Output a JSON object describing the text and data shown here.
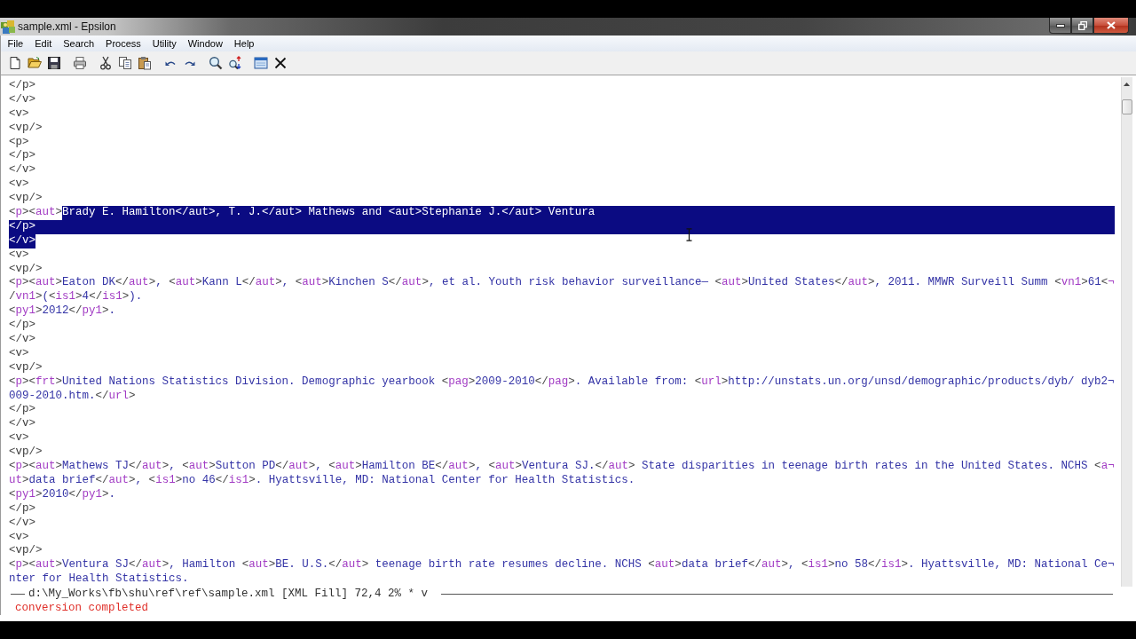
{
  "window": {
    "title": "sample.xml - Epsilon"
  },
  "menu": [
    "File",
    "Edit",
    "Search",
    "Process",
    "Utility",
    "Window",
    "Help"
  ],
  "editor": {
    "lines": [
      {
        "kind": "markup",
        "text": "</p>",
        "selected": false
      },
      {
        "kind": "markup",
        "text": "</v>",
        "selected": false
      },
      {
        "kind": "markup",
        "text": "<v>",
        "selected": false
      },
      {
        "kind": "markup",
        "text": "<vp/>",
        "selected": false
      },
      {
        "kind": "markup",
        "text": "<p>",
        "selected": false
      },
      {
        "kind": "markup",
        "text": "</p>",
        "selected": false
      },
      {
        "kind": "markup",
        "text": "</v>",
        "selected": false
      },
      {
        "kind": "markup",
        "text": "<v>",
        "selected": false
      },
      {
        "kind": "markup",
        "text": "<vp/>",
        "selected": false
      },
      {
        "kind": "content",
        "text": "<p><aut>",
        "selected_text": "Brady E. Hamilton</aut>, T. J.</aut> Mathews and <aut>Stephanie J.</aut> Ventura",
        "selected": true
      },
      {
        "kind": "markup",
        "text": "</p>",
        "selected": true
      },
      {
        "kind": "markup",
        "text": "</v>",
        "selected": true
      },
      {
        "kind": "markup",
        "text": "<v>",
        "selected": false
      },
      {
        "kind": "markup",
        "text": "<vp/>",
        "selected": false
      },
      {
        "kind": "content",
        "text": "<p><aut>Eaton DK</aut>, <aut>Kann L</aut>, <aut>Kinchen S</aut>, et al. Youth risk behavior surveillance— <aut>United States</aut>, 2011. MMWR Surveill Summ <vn1>61<¬",
        "selected": false
      },
      {
        "kind": "content",
        "text": "/vn1>(<is1>4</is1>).",
        "selected": false
      },
      {
        "kind": "content",
        "text": "<py1>2012</py1>.",
        "selected": false
      },
      {
        "kind": "markup",
        "text": "</p>",
        "selected": false
      },
      {
        "kind": "markup",
        "text": "</v>",
        "selected": false
      },
      {
        "kind": "markup",
        "text": "<v>",
        "selected": false
      },
      {
        "kind": "markup",
        "text": "<vp/>",
        "selected": false
      },
      {
        "kind": "content",
        "text": "<p><frt>United Nations Statistics Division. Demographic yearbook <pag>2009-2010</pag>. Available from: <url>http://unstats.un.org/unsd/demographic/products/dyb/ dyb2¬",
        "selected": false
      },
      {
        "kind": "content",
        "text": "009-2010.htm.</url>",
        "selected": false
      },
      {
        "kind": "markup",
        "text": "</p>",
        "selected": false
      },
      {
        "kind": "markup",
        "text": "</v>",
        "selected": false
      },
      {
        "kind": "markup",
        "text": "<v>",
        "selected": false
      },
      {
        "kind": "markup",
        "text": "<vp/>",
        "selected": false
      },
      {
        "kind": "content",
        "text": "<p><aut>Mathews TJ</aut>, <aut>Sutton PD</aut>, <aut>Hamilton BE</aut>, <aut>Ventura SJ.</aut> State disparities in teenage birth rates in the United States. NCHS <a¬",
        "selected": false
      },
      {
        "kind": "content",
        "text": "ut>data brief</aut>, <is1>no 46</is1>. Hyattsville, MD: National Center for Health Statistics.",
        "selected": false
      },
      {
        "kind": "content",
        "text": "<py1>2010</py1>.",
        "selected": false
      },
      {
        "kind": "markup",
        "text": "</p>",
        "selected": false
      },
      {
        "kind": "markup",
        "text": "</v>",
        "selected": false
      },
      {
        "kind": "markup",
        "text": "<v>",
        "selected": false
      },
      {
        "kind": "markup",
        "text": "<vp/>",
        "selected": false
      },
      {
        "kind": "content",
        "text": "<p><aut>Ventura SJ</aut>, Hamilton <aut>BE. U.S.</aut> teenage birth rate resumes decline. NCHS <aut>data brief</aut>, <is1>no 58</is1>. Hyattsville, MD: National Ce¬",
        "selected": false
      },
      {
        "kind": "content",
        "text": "nter for Health Statistics.",
        "selected": false
      }
    ]
  },
  "mode_line": "d:\\My_Works\\fb\\shu\\ref\\ref\\sample.xml [XML Fill] 72,4 2% * v",
  "message": "conversion completed"
}
